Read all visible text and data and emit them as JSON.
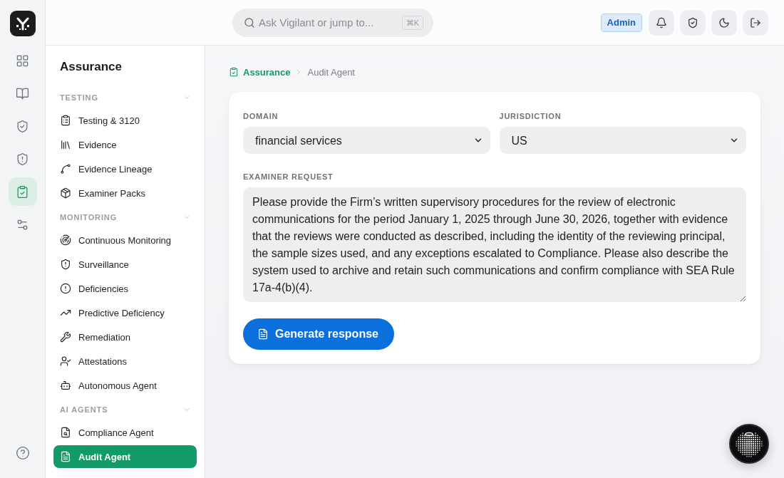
{
  "rail": {
    "items": [
      {
        "selected": false
      },
      {
        "selected": false
      },
      {
        "selected": false
      },
      {
        "selected": false
      },
      {
        "selected": true
      },
      {
        "selected": false
      }
    ]
  },
  "top_bar": {
    "search": {
      "placeholder": "Ask Vigilant or jump to...",
      "shortcut": "⌘K"
    },
    "role_badge": "Admin"
  },
  "sidebar": {
    "title": "Assurance",
    "sections": [
      {
        "heading": "TESTING",
        "expanded": true,
        "items": [
          {
            "label": "Testing & 3120",
            "selected": false
          },
          {
            "label": "Evidence",
            "selected": false
          },
          {
            "label": "Evidence Lineage",
            "selected": false
          },
          {
            "label": "Examiner Packs",
            "selected": false
          }
        ]
      },
      {
        "heading": "MONITORING",
        "expanded": true,
        "items": [
          {
            "label": "Continuous Monitoring",
            "selected": false
          },
          {
            "label": "Surveillance",
            "selected": false
          },
          {
            "label": "Deficiencies",
            "selected": false
          },
          {
            "label": "Predictive Deficiency",
            "selected": false
          },
          {
            "label": "Remediation",
            "selected": false
          },
          {
            "label": "Attestations",
            "selected": false
          },
          {
            "label": "Autonomous Agent",
            "selected": false
          }
        ]
      },
      {
        "heading": "AI AGENTS",
        "expanded": true,
        "items": [
          {
            "label": "Compliance Agent",
            "selected": false
          },
          {
            "label": "Audit Agent",
            "selected": true
          }
        ]
      }
    ]
  },
  "breadcrumb": [
    "Assurance",
    "Audit Agent"
  ],
  "form": {
    "fields": [
      {
        "kind": "select",
        "label": "DOMAIN",
        "value": "financial services"
      },
      {
        "kind": "select",
        "label": "JURISDICTION",
        "value": "US"
      },
      {
        "kind": "textarea",
        "label": "EXAMINER REQUEST",
        "value": "Please provide the Firm’s written supervisory procedures for the review of electronic communications for the period January 1, 2025 through June 30, 2026, together with evidence that the reviews were conducted as described, including the identity of the reviewing principal, the sample sizes used, and any exceptions escalated to Compliance. Please also describe the system used to archive and retain such communications and confirm compliance with SEA Rule 17a-4(b)(4)."
      }
    ],
    "submit": "Generate response"
  }
}
